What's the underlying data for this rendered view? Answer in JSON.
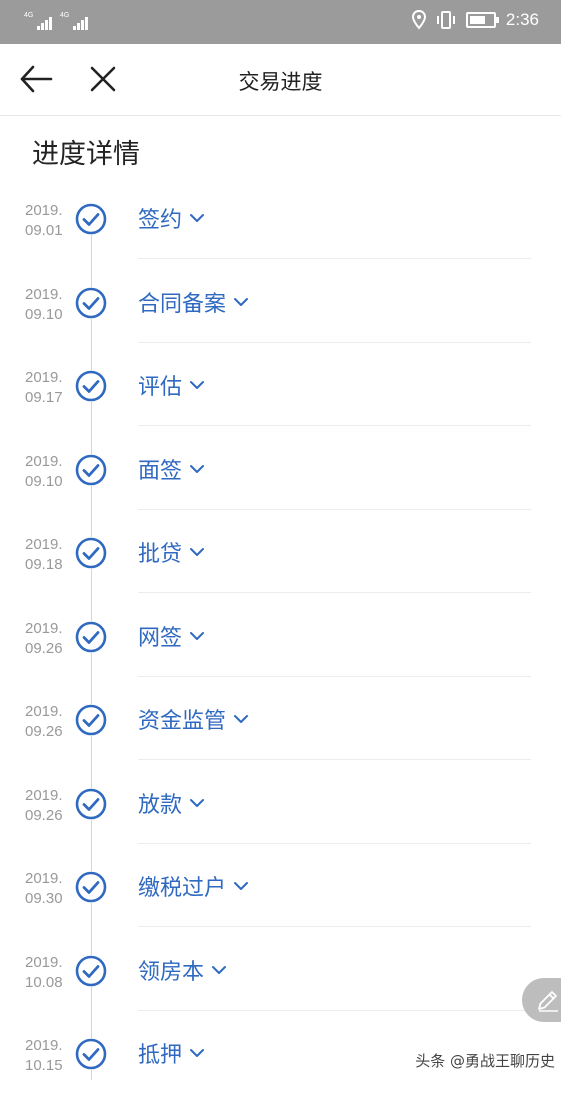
{
  "status_bar": {
    "network_1": "4G",
    "network_2": "4G",
    "time": "2:36"
  },
  "nav": {
    "title": "交易进度"
  },
  "section": {
    "title": "进度详情"
  },
  "steps": [
    {
      "date_year": "2019.",
      "date_md": "09.01",
      "label": "签约"
    },
    {
      "date_year": "2019.",
      "date_md": "09.10",
      "label": "合同备案"
    },
    {
      "date_year": "2019.",
      "date_md": "09.17",
      "label": "评估"
    },
    {
      "date_year": "2019.",
      "date_md": "09.10",
      "label": "面签"
    },
    {
      "date_year": "2019.",
      "date_md": "09.18",
      "label": "批贷"
    },
    {
      "date_year": "2019.",
      "date_md": "09.26",
      "label": "网签"
    },
    {
      "date_year": "2019.",
      "date_md": "09.26",
      "label": "资金监管"
    },
    {
      "date_year": "2019.",
      "date_md": "09.26",
      "label": "放款"
    },
    {
      "date_year": "2019.",
      "date_md": "09.30",
      "label": "缴税过户"
    },
    {
      "date_year": "2019.",
      "date_md": "10.08",
      "label": "领房本"
    },
    {
      "date_year": "2019.",
      "date_md": "10.15",
      "label": "抵押"
    }
  ],
  "colors": {
    "accent": "#2f69c0",
    "status_bar": "#9b9b9b",
    "date_text": "#999999"
  },
  "watermark": "头条 @勇战王聊历史"
}
